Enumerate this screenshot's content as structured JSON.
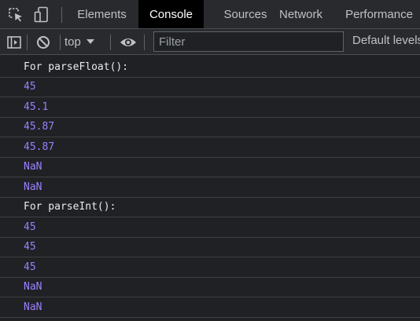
{
  "tabs": [
    {
      "label": "Elements",
      "active": false
    },
    {
      "label": "Console",
      "active": true
    },
    {
      "label": "Sources",
      "active": false
    },
    {
      "label": "Network",
      "active": false
    },
    {
      "label": "Performance",
      "active": false
    }
  ],
  "toolbar": {
    "context": "top",
    "filter_placeholder": "Filter",
    "levels": "Default levels"
  },
  "messages": [
    {
      "text": "For parseFloat():",
      "kind": "text"
    },
    {
      "text": "45",
      "kind": "number"
    },
    {
      "text": "45.1",
      "kind": "number"
    },
    {
      "text": "45.87",
      "kind": "number"
    },
    {
      "text": "45.87",
      "kind": "number"
    },
    {
      "text": "NaN",
      "kind": "number"
    },
    {
      "text": "NaN",
      "kind": "number"
    },
    {
      "text": "For parseInt():",
      "kind": "text"
    },
    {
      "text": "45",
      "kind": "number"
    },
    {
      "text": "45",
      "kind": "number"
    },
    {
      "text": "45",
      "kind": "number"
    },
    {
      "text": "NaN",
      "kind": "number"
    },
    {
      "text": "NaN",
      "kind": "number"
    }
  ],
  "colors": {
    "background": "#202124",
    "toolbar": "#292a2d",
    "active_tab": "#000000",
    "number_output": "#9980ff",
    "text_output": "#e8eaed"
  },
  "icons": [
    "inspect-element-icon",
    "device-toolbar-icon",
    "sidebar-toggle-icon",
    "clear-console-icon",
    "dropdown-arrow-icon",
    "live-expression-eye-icon"
  ]
}
